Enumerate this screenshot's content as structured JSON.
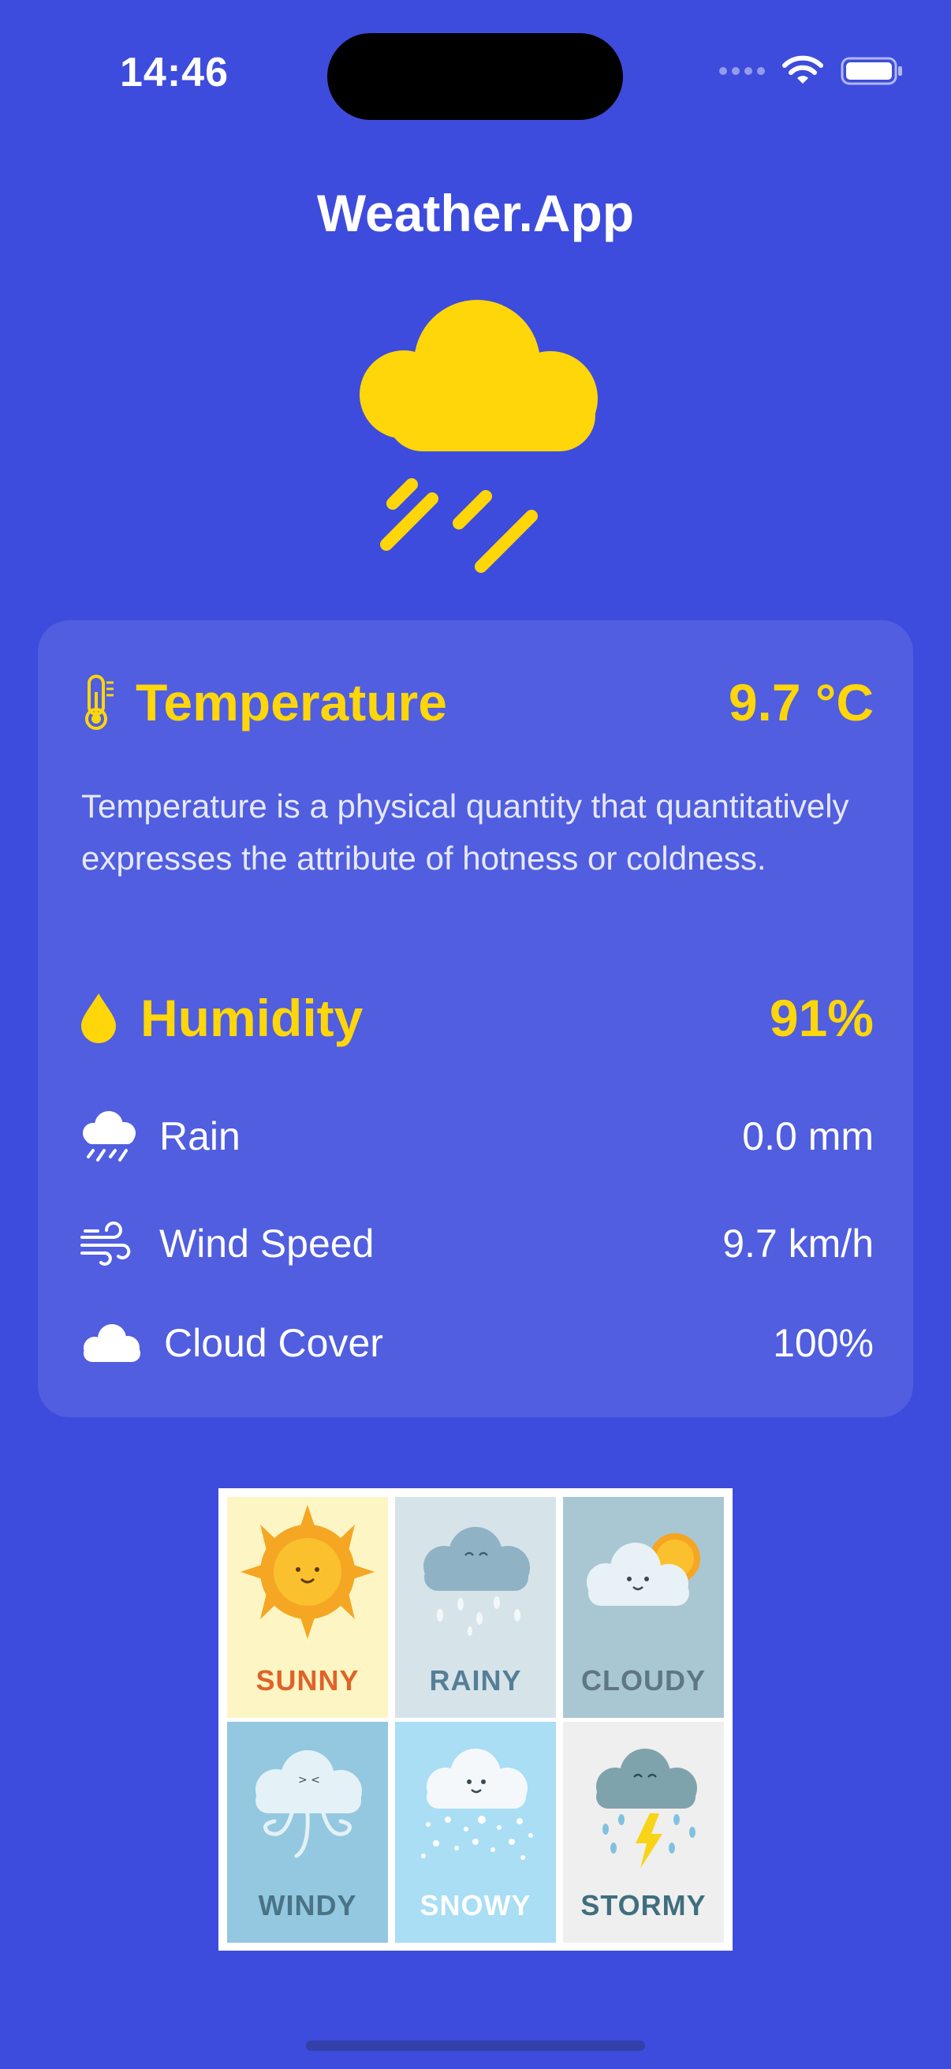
{
  "status_bar": {
    "time": "14:46"
  },
  "app": {
    "title": "Weather.App"
  },
  "colors": {
    "background": "#3d4cdc",
    "accent": "#ffd60a"
  },
  "temperature": {
    "label": "Temperature",
    "value": "9.7 °C",
    "description": "Temperature is a physical quantity that quantitatively expresses the attribute of hotness or coldness."
  },
  "humidity": {
    "label": "Humidity",
    "value": "91%"
  },
  "details": [
    {
      "icon": "cloud-rain-icon",
      "label": "Rain",
      "value": "0.0 mm"
    },
    {
      "icon": "wind-icon",
      "label": "Wind Speed",
      "value": "9.7 km/h"
    },
    {
      "icon": "cloud-icon",
      "label": "Cloud Cover",
      "value": "100%"
    }
  ],
  "weather_types": {
    "tiles": [
      {
        "label": "SUNNY",
        "bg": "#fdf6c4",
        "color": "#e0622b"
      },
      {
        "label": "RAINY",
        "bg": "#d6e4ea",
        "color": "#557f96"
      },
      {
        "label": "CLOUDY",
        "bg": "#a9c7d3",
        "color": "#5f7782"
      },
      {
        "label": "WINDY",
        "bg": "#93c8e0",
        "color": "#4a7386"
      },
      {
        "label": "SNOWY",
        "bg": "#a9def5",
        "color": "#ffffff"
      },
      {
        "label": "STORMY",
        "bg": "#efefef",
        "color": "#3f6f7e"
      }
    ]
  }
}
